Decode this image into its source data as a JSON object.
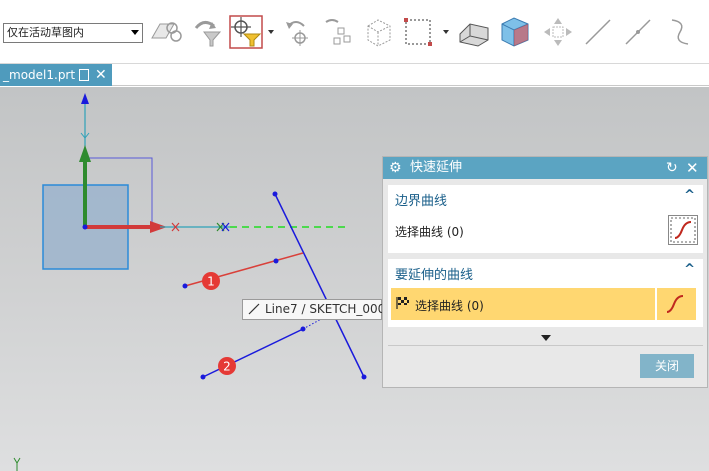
{
  "toolbar": {
    "filter_value": "仅在活动草图内"
  },
  "tab": {
    "label": "_model1.prt",
    "close_glyph": "✕"
  },
  "tooltip": {
    "text": "Line7 / SKETCH_000"
  },
  "markers": {
    "one": "1",
    "two": "2"
  },
  "dialog": {
    "title": "快速延伸",
    "section_boundary": {
      "header": "边界曲线",
      "select_label": "选择曲线 (0)"
    },
    "section_extend": {
      "header": "要延伸的曲线",
      "select_label": "选择曲线 (0)"
    },
    "close_button": "关闭"
  },
  "colors": {
    "accent": "#5ba4c2",
    "tab": "#4f9bbd",
    "highlight_row": "#ffd771",
    "section_header": "#1a5f8a",
    "close_button": "#82b4c9",
    "curve_blue": "#1a1adc",
    "curve_red": "#d9403a",
    "marker_red": "#e53935"
  }
}
